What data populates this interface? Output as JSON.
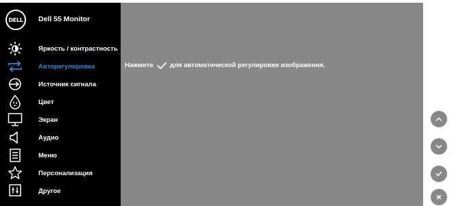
{
  "menu": {
    "logo_text": "DELL",
    "title": "Dell 55 Monitor",
    "items": [
      {
        "label": "Яркость / контрастность",
        "icon": "brightness-icon"
      },
      {
        "label": "Авторегулировка",
        "icon": "auto-adjust-icon"
      },
      {
        "label": "Источник сигнала",
        "icon": "input-source-icon"
      },
      {
        "label": "Цвет",
        "icon": "color-icon"
      },
      {
        "label": "Экран",
        "icon": "display-icon"
      },
      {
        "label": "Аудио",
        "icon": "audio-icon"
      },
      {
        "label": "Меню",
        "icon": "menu-icon"
      },
      {
        "label": "Персонализация",
        "icon": "personalize-icon"
      },
      {
        "label": "Другое",
        "icon": "others-icon"
      }
    ],
    "active_index": 1
  },
  "content": {
    "message_before": "Нажмите",
    "message_after": "для автоматической регулировки изображения."
  },
  "buttons": [
    {
      "icon": "chevron-up-icon"
    },
    {
      "icon": "chevron-down-icon"
    },
    {
      "icon": "check-icon"
    },
    {
      "icon": "close-icon"
    }
  ],
  "colors": {
    "accent": "#2b8ad6",
    "panel_bg": "#888888",
    "menu_bg": "#000000"
  }
}
